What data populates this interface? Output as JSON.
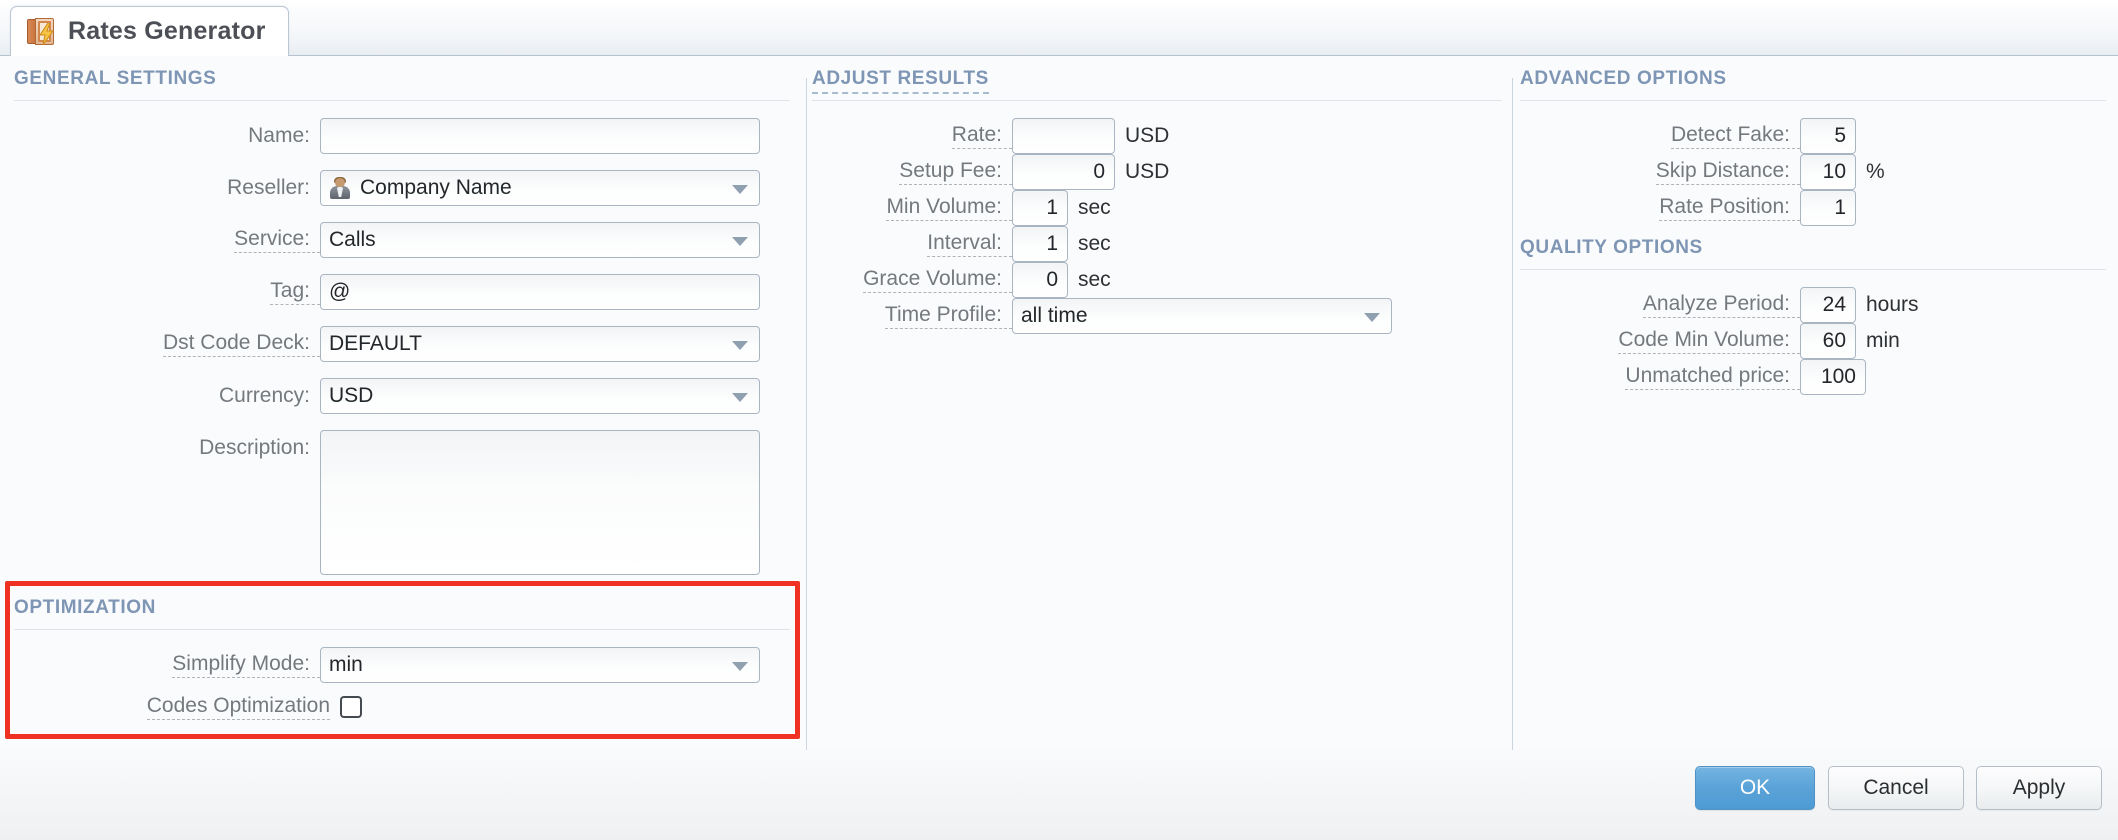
{
  "tab": {
    "title": "Rates Generator",
    "icon": "rates-book-bolt-icon"
  },
  "sections": {
    "general": "GENERAL SETTINGS",
    "optimization": "OPTIMIZATION",
    "adjust": "ADJUST RESULTS",
    "advanced": "ADVANCED OPTIONS",
    "quality": "QUALITY OPTIONS"
  },
  "general": {
    "name": {
      "label": "Name:",
      "value": ""
    },
    "reseller": {
      "label": "Reseller:",
      "value": "Company Name"
    },
    "service": {
      "label": "Service:",
      "value": "Calls"
    },
    "tag": {
      "label": "Tag:",
      "value": "@"
    },
    "dstcodedeck": {
      "label": "Dst Code Deck:",
      "value": "DEFAULT"
    },
    "currency": {
      "label": "Currency:",
      "value": "USD"
    },
    "description": {
      "label": "Description:",
      "value": ""
    }
  },
  "optimization": {
    "simplify_mode": {
      "label": "Simplify Mode:",
      "value": "min"
    },
    "codes_optimization": {
      "label": "Codes Optimization",
      "checked": false
    }
  },
  "adjust": {
    "rate": {
      "label": "Rate:",
      "value": "",
      "unit": "USD"
    },
    "setup_fee": {
      "label": "Setup Fee:",
      "value": "0",
      "unit": "USD"
    },
    "min_volume": {
      "label": "Min Volume:",
      "value": "1",
      "unit": "sec"
    },
    "interval": {
      "label": "Interval:",
      "value": "1",
      "unit": "sec"
    },
    "grace_volume": {
      "label": "Grace Volume:",
      "value": "0",
      "unit": "sec"
    },
    "time_profile": {
      "label": "Time Profile:",
      "value": "all time"
    }
  },
  "advanced": {
    "detect_fake": {
      "label": "Detect Fake:",
      "value": "5",
      "unit": ""
    },
    "skip_distance": {
      "label": "Skip Distance:",
      "value": "10",
      "unit": "%"
    },
    "rate_position": {
      "label": "Rate Position:",
      "value": "1",
      "unit": ""
    }
  },
  "quality": {
    "analyze_period": {
      "label": "Analyze Period:",
      "value": "24",
      "unit": "hours"
    },
    "code_min_volume": {
      "label": "Code Min Volume:",
      "value": "60",
      "unit": "min"
    },
    "unmatched_price": {
      "label": "Unmatched price:",
      "value": "100",
      "unit": ""
    }
  },
  "footer": {
    "ok": "OK",
    "cancel": "Cancel",
    "apply": "Apply"
  },
  "colors": {
    "section_header": "#7e96b4",
    "primary_button": "#5aa3d8",
    "highlight_box": "#ef3124",
    "label_text": "#74797e"
  }
}
